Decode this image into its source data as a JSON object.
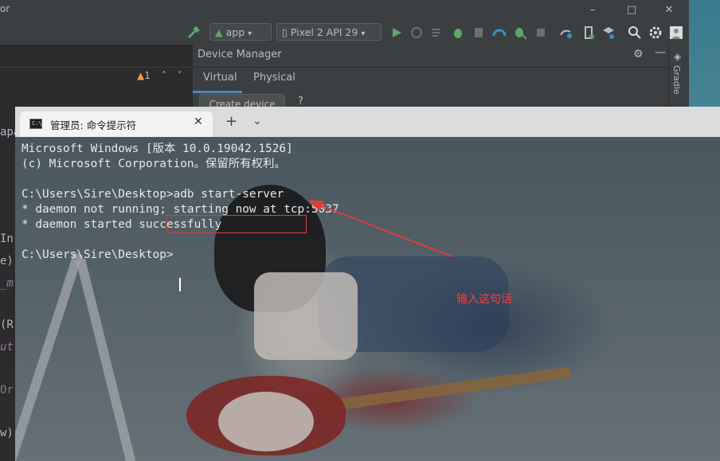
{
  "ide": {
    "window_title_fragment": "or",
    "toolbar": {
      "run_config": "app",
      "device": "Pixel 2 API 29"
    },
    "editor": {
      "warning_count": "1",
      "code_fragments": [
        "apa",
        "In",
        "e)",
        "_m",
        "(R",
        "ut",
        "Or",
        "w)"
      ]
    },
    "device_manager": {
      "title": "Device Manager",
      "tabs": [
        "Virtual",
        "Physical"
      ],
      "create_device": "Create device",
      "help": "?"
    },
    "side_tool": "Gradle"
  },
  "cmd": {
    "tab_title": "管理员: 命令提示符",
    "tab_icon_text": "C:\\",
    "lines": [
      "Microsoft Windows [版本 10.0.19042.1526]",
      "(c) Microsoft Corporation。保留所有权利。",
      "",
      "C:\\Users\\Sire\\Desktop>adb start-server",
      "* daemon not running; starting now at tcp:5037",
      "* daemon started successfully",
      "",
      "C:\\Users\\Sire\\Desktop>"
    ]
  },
  "annotation": {
    "label": "输入这句话",
    "color": "#e23b3b"
  },
  "colors": {
    "ide_bg": "#2b2b2b",
    "ide_panel": "#3c3f41",
    "accent_tab": "#4a88c7",
    "console_text": "#e8e8e8"
  }
}
